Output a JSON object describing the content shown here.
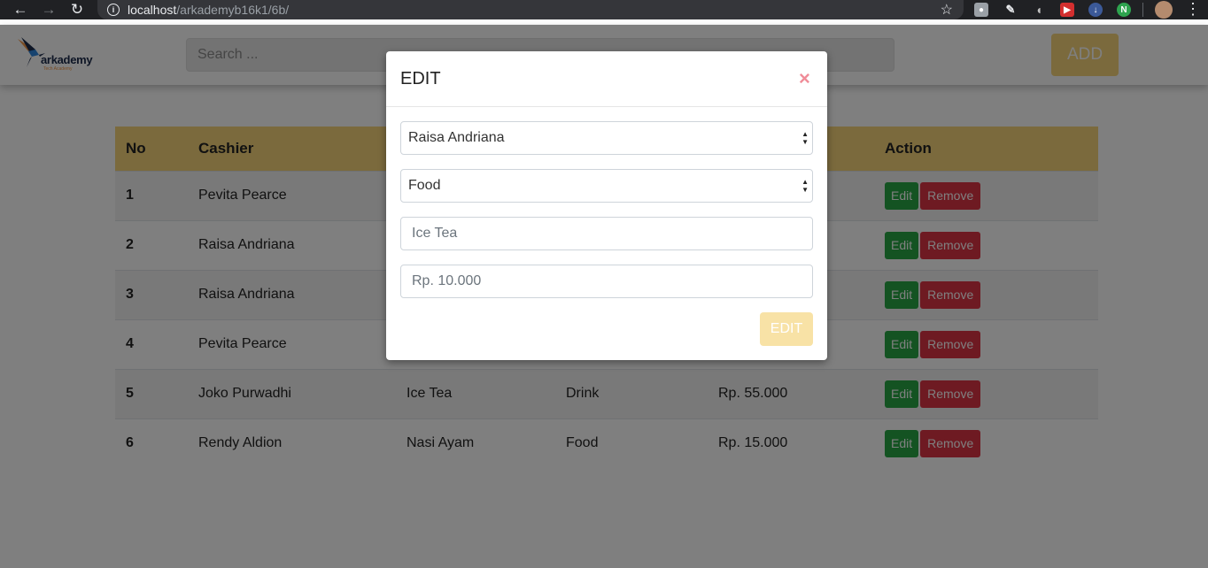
{
  "browser": {
    "url_host": "localhost",
    "url_path": "/arkademyb16k1/6b/",
    "extensions": [
      "camera-icon",
      "pen-icon",
      "arc-icon",
      "red-play-icon",
      "blue-download-icon",
      "green-n-icon"
    ]
  },
  "navbar": {
    "logo_text": "arkademy",
    "logo_sub": "Tech Academy",
    "search_placeholder": "Search ...",
    "add_label": "ADD"
  },
  "table": {
    "headers": {
      "no": "No",
      "cashier": "Cashier",
      "action": "Action"
    },
    "rows": [
      {
        "no": "1",
        "cashier": "Pevita Pearce",
        "product": "",
        "category": "",
        "price": ""
      },
      {
        "no": "2",
        "cashier": "Raisa Andriana",
        "product": "",
        "category": "",
        "price": ""
      },
      {
        "no": "3",
        "cashier": "Raisa Andriana",
        "product": "",
        "category": "",
        "price": ""
      },
      {
        "no": "4",
        "cashier": "Pevita Pearce",
        "product": "",
        "category": "",
        "price": ""
      },
      {
        "no": "5",
        "cashier": "Joko Purwadhi",
        "product": "Ice Tea",
        "category": "Drink",
        "price": "Rp. 55.000"
      },
      {
        "no": "6",
        "cashier": "Rendy Aldion",
        "product": "Nasi Ayam",
        "category": "Food",
        "price": "Rp. 15.000"
      }
    ],
    "edit_label": "Edit",
    "remove_label": "Remove"
  },
  "modal": {
    "title": "EDIT",
    "close": "×",
    "cashier_select": "Raisa Andriana",
    "category_select": "Food",
    "product_value": "Ice Tea",
    "price_value": "Rp. 10.000",
    "submit_label": "EDIT"
  },
  "colors": {
    "accent": "#f6d47a",
    "edit_green": "#28a745",
    "remove_red": "#dc3545"
  }
}
